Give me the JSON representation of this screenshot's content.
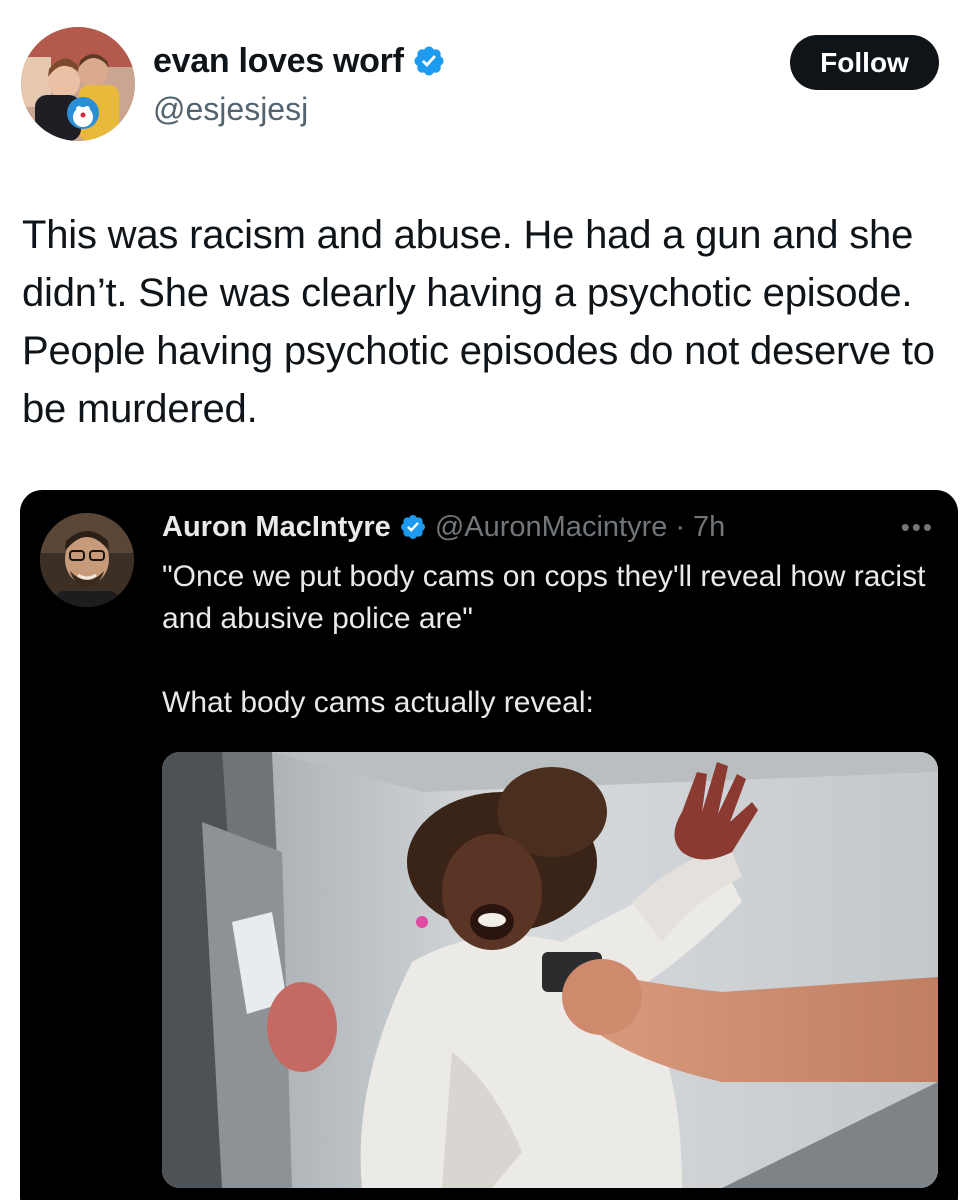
{
  "author": {
    "name": "evan loves worf",
    "handle": "@esjesjesj",
    "verified": true
  },
  "follow_label": "Follow",
  "tweet_text": "This was racism and abuse. He had a gun and she didn’t. She was clearly having a psychotic episode. People having psychotic episodes do not deserve to be murdered.",
  "quoted": {
    "name": "Auron MacIntyre",
    "handle": "@AuronMacintyre",
    "separator": "·",
    "time": "7h",
    "verified": true,
    "more_icon": "ellipsis-icon",
    "line1": "\"Once we put body cams on cops they'll reveal how racist and abusive police are\"",
    "line2": "What body cams actually reveal:"
  },
  "colors": {
    "verified_blue": "#1d9bf0",
    "follow_bg": "#0f1419",
    "quote_bg": "#000000",
    "muted_dark": "#71767b",
    "muted_light": "#536471"
  }
}
